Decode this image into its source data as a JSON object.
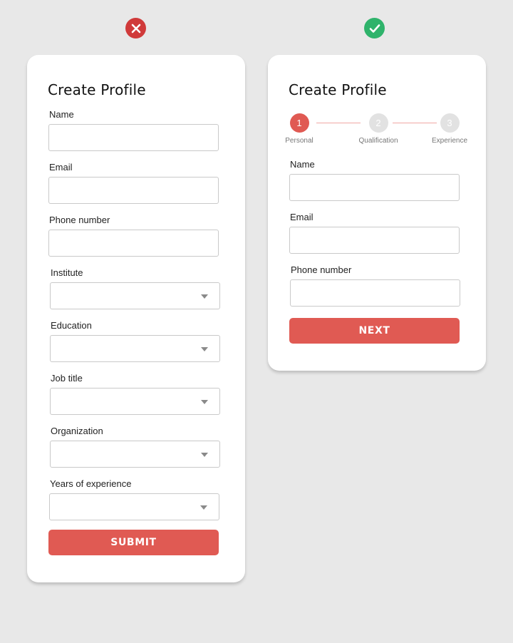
{
  "comparison": {
    "bad_icon": "close-icon",
    "good_icon": "check-icon",
    "bad_color": "#d03a3a",
    "good_color": "#2fb36b"
  },
  "left_form": {
    "title": "Create Profile",
    "fields": [
      {
        "label": "Name",
        "type": "text",
        "value": ""
      },
      {
        "label": "Email",
        "type": "text",
        "value": ""
      },
      {
        "label": "Phone number",
        "type": "text",
        "value": ""
      },
      {
        "label": "Institute",
        "type": "select",
        "value": ""
      },
      {
        "label": "Education",
        "type": "select",
        "value": ""
      },
      {
        "label": "Job title",
        "type": "select",
        "value": ""
      },
      {
        "label": "Organization",
        "type": "select",
        "value": ""
      },
      {
        "label": "Years of experience",
        "type": "select",
        "value": ""
      }
    ],
    "submit_label": "SUBMIT"
  },
  "right_form": {
    "title": "Create Profile",
    "steps": [
      {
        "number": "1",
        "label": "Personal",
        "state": "active"
      },
      {
        "number": "2",
        "label": "Qualification",
        "state": "todo"
      },
      {
        "number": "3",
        "label": "Experience",
        "state": "todo"
      }
    ],
    "fields": [
      {
        "label": "Name",
        "type": "text",
        "value": ""
      },
      {
        "label": "Email",
        "type": "text",
        "value": ""
      },
      {
        "label": "Phone number",
        "type": "text",
        "value": ""
      }
    ],
    "next_label": "NEXT"
  },
  "accent_color": "#e05a53"
}
